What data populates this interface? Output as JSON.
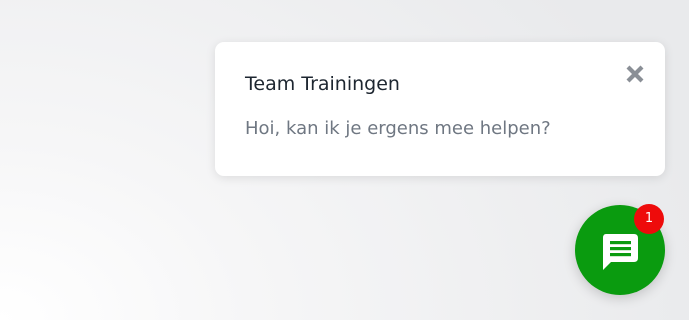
{
  "popup": {
    "title": "Team Trainingen",
    "message": "Hoi, kan ik je ergens mee helpen?",
    "close_icon": "close-icon"
  },
  "fab": {
    "icon": "chat-bubble-icon",
    "badge_count": "1"
  },
  "colors": {
    "fab_background": "#0a9b0f",
    "badge_background": "#ee0b0b",
    "title_text": "#1d2630",
    "message_text": "#6f7782",
    "close_icon": "#8a8f96"
  }
}
